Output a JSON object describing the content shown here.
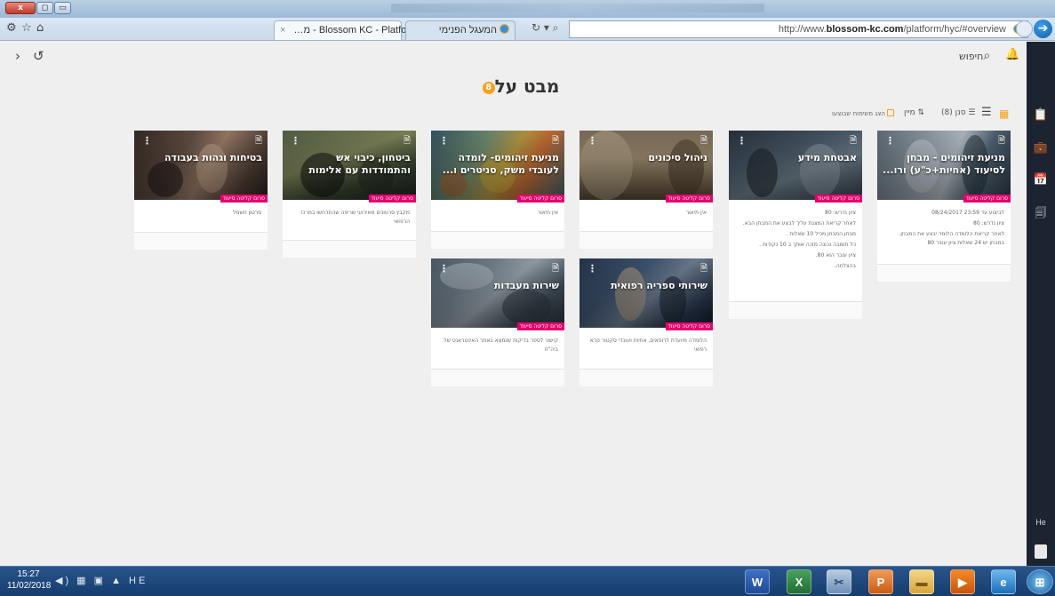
{
  "window": {
    "close_label": "x",
    "maximize_label": "◻",
    "minimize_label": "▭"
  },
  "browser": {
    "toolbar_icons": [
      "⚙",
      "☆",
      "⌂"
    ],
    "tabs": [
      {
        "label": "…מ - Blossom KC - Platform",
        "close": "×"
      },
      {
        "label": "המעגל הפנימי"
      }
    ],
    "nav_controls": "↻ ▾ ⌕",
    "url_prefix": "http://www.",
    "url_domain": "blossom-kc.com",
    "url_path": "/platform/hyc/#overview",
    "go_label": "➔"
  },
  "app": {
    "back_icon": "›",
    "refresh_icon": "↺",
    "bell_icon": "🔔",
    "search_label": "חיפוש",
    "search_icon": "⌕",
    "page_title": "מבט על",
    "title_badge": "8",
    "toolbar": {
      "grid_icon": "▦",
      "list_icon": "☰",
      "sort_label": "סנן",
      "sort_count": "(8)",
      "filter_label": "מיין",
      "show_completed_label": "הצג משימות שבוצעו"
    }
  },
  "cards": [
    {
      "title": "מניעת זיהומים - מבחן לסיעוד (אחיות+כ\"ע) ורו...",
      "tag": "סרום קליטה סיעוד",
      "body": [
        "לביצוע עד 23:59 08/24/2017",
        "ציון נדרש: 80",
        "לאחר קריאת הלומדה הלומד יבצע את המבחן. במבחן יש 24 שאלות ציון עובר 80"
      ]
    },
    {
      "title": "אבטחת מידע",
      "tag": "סרום קליטה סיעוד",
      "body": [
        "ציון נדרש: 80",
        "לאחר קריאת המצגת עליך לבצע את המבחן הבא.",
        "מבחן המבחן מכיל 10 שאלות .",
        "כל תשובה נכונה מזכה אותך ב 10 נקודות .",
        "ציון עובר הוא 80.",
        "בהצלחה."
      ]
    },
    {
      "title": "ניהול סיכונים",
      "tag": "סרום קליטה סיעוד",
      "body": [
        "אין תיאור"
      ]
    },
    {
      "title": "מניעת זיהומים- לומדה לעובדי משק, סניטרים ו...",
      "tag": "סרום קליטה סיעוד",
      "body": [
        "אין תיאור"
      ]
    },
    {
      "title": "ביטחון, כיבוי אש והתמודדות עם אלימות",
      "tag": "סרום קליטה סיעוד",
      "body": [
        "מקבץ סרטונים מאירועי שריפה שהתרחשו במרכז הרפואי"
      ]
    },
    {
      "title": "בטיחות וגהות בעבודה",
      "tag": "סרום קליטה סיעוד",
      "body": [
        "סרטון חשמל"
      ]
    },
    {
      "title": "שירותי ספריה רפואית",
      "tag": "סרום קליטה סיעוד",
      "body": [
        "הלומדה מיועדת לרופאים, אחיות ועובדי סקטור פרא רפואי"
      ]
    },
    {
      "title": "שירות מעבדות",
      "tag": "סרום קליטה סיעוד",
      "body": [
        "קישור לספר בדיקות שנמצא באתר האינטראנט של ביה\"ח"
      ]
    }
  ],
  "card_icons": {
    "menu": "⋮",
    "doc": "🗎"
  },
  "sidebar": {
    "icons": [
      "📋",
      "💼",
      "📅",
      "🗐"
    ],
    "lang": "He"
  },
  "taskbar": {
    "time": "15:27",
    "date": "11/02/2018",
    "tray": "◀) ▦ ▣ ▲ HE",
    "apps": [
      "W",
      "X",
      "✂",
      "P",
      "▬",
      "▶",
      "e",
      "⊞"
    ]
  },
  "colors": {
    "accent": "#f7a21b",
    "tag": "#e5006d",
    "sidebar": "#1c2331",
    "background": "#efefef"
  }
}
